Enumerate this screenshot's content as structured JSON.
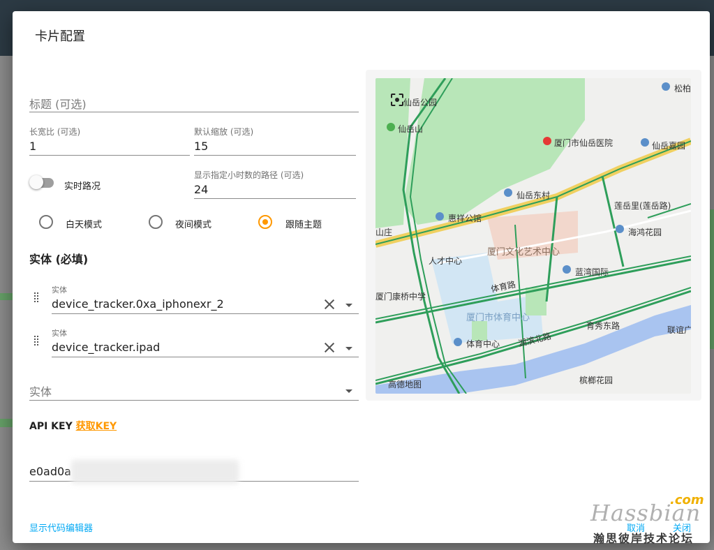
{
  "dialog": {
    "title": "卡片配置"
  },
  "title_field": {
    "placeholder": "标题 (可选)"
  },
  "aspect_ratio": {
    "label": "长宽比 (可选)",
    "value": "1"
  },
  "default_zoom": {
    "label": "默认缩放 (可选)",
    "value": "15"
  },
  "traffic": {
    "label": "实时路况",
    "enabled": false
  },
  "hours_to_show": {
    "label": "显示指定小时数的路径 (可选)",
    "value": "24"
  },
  "mode": {
    "options": [
      "白天模式",
      "夜间模式",
      "跟随主题"
    ],
    "selected": "跟随主题"
  },
  "entities": {
    "heading": "实体 (必填)",
    "items": [
      {
        "label": "实体",
        "value": "device_tracker.0xa_iphonexr_2"
      },
      {
        "label": "实体",
        "value": "device_tracker.ipad"
      }
    ],
    "add_placeholder": "实体"
  },
  "api_key": {
    "label": "API KEY",
    "link_text": "获取KEY",
    "value": "e0ad0a"
  },
  "footer": {
    "show_code_editor": "显示代码编辑器",
    "cancel": "取消",
    "close": "关闭"
  },
  "map": {
    "labels": {
      "park": "仙岳公园",
      "mountain": "仙岳山",
      "hospital": "厦门市仙岳医院",
      "garden1": "仙岳嘉园",
      "east_village": "仙岳东村",
      "songbai": "松柏",
      "huixiang": "惠祥公馆",
      "lianyueli": "莲岳里(莲岳路)",
      "haihong": "海鸿花园",
      "shanzhuang": "山庄",
      "talent": "人才中心",
      "art_center": "厦门文化艺术中心",
      "lanwan": "蓝湾国际",
      "tiyu_road": "体育路",
      "kangqiao": "厦门康桥中学",
      "sports_center": "厦门市体育中心",
      "yuxiu_east": "育秀东路",
      "lianjian": "联谊广",
      "sports_center2": "体育中心",
      "hubin_north": "湖滨北路",
      "binglang": "槟榔花园",
      "yuxiu": "育秀东路",
      "brand": "高德地图"
    }
  },
  "watermark": {
    "brand": "Hassbian",
    "tld": ".com",
    "slogan": "瀚思彼岸技术论坛"
  }
}
